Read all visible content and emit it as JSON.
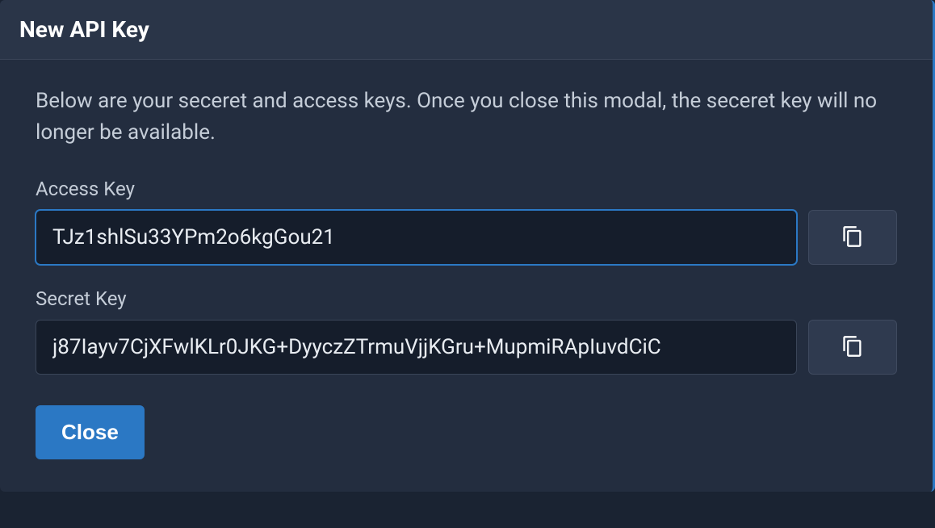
{
  "modal": {
    "title": "New API Key",
    "description": "Below are your seceret and access keys. Once you close this modal, the seceret key will no longer be available.",
    "fields": {
      "access": {
        "label": "Access Key",
        "value": "TJz1shlSu33YPm2o6kgGou21"
      },
      "secret": {
        "label": "Secret Key",
        "value": "j87Iayv7CjXFwlKLr0JKG+DyyczZTrmuVjjKGru+MupmiRApIuvdCiC"
      }
    },
    "close_label": "Close"
  }
}
